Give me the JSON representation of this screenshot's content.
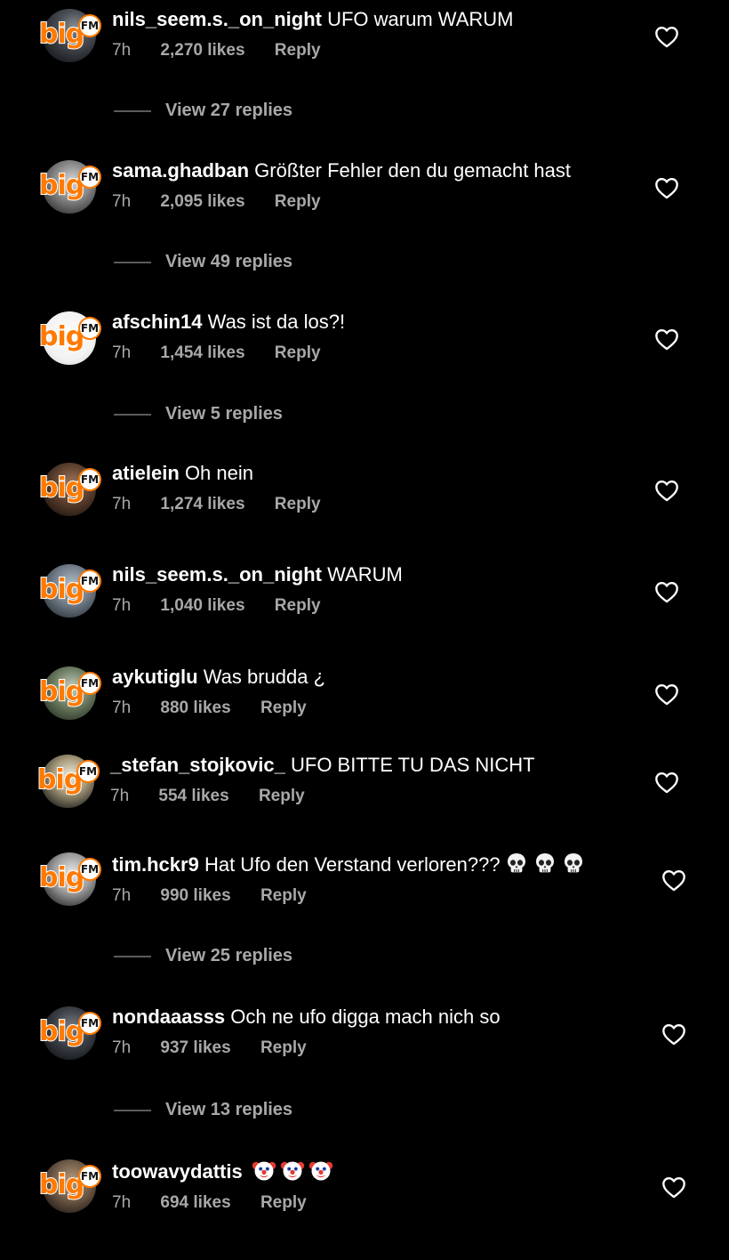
{
  "brand": {
    "logo_text": "big",
    "logo_badge": "FM",
    "logo_color": "#ff7a00"
  },
  "comments": [
    {
      "user": "nils_seem.s._on_night",
      "text": "UFO warum WARUM",
      "time": "7h",
      "likes": "2,270 likes",
      "reply": "Reply",
      "view_replies": "View 27 replies"
    },
    {
      "user": "sama.ghadban",
      "text": "Größter Fehler den du gemacht hast",
      "time": "7h",
      "likes": "2,095 likes",
      "reply": "Reply",
      "view_replies": "View 49 replies"
    },
    {
      "user": "afschin14",
      "text": "Was ist da los?!",
      "time": "7h",
      "likes": "1,454 likes",
      "reply": "Reply",
      "view_replies": "View 5 replies"
    },
    {
      "user": "atielein",
      "text": "Oh nein",
      "time": "7h",
      "likes": "1,274 likes",
      "reply": "Reply"
    },
    {
      "user": "nils_seem.s._on_night",
      "text": "WARUM",
      "time": "7h",
      "likes": "1,040 likes",
      "reply": "Reply"
    },
    {
      "user": "aykutiglu",
      "text": "Was brudda ¿",
      "time": "7h",
      "likes": "880 likes",
      "reply": "Reply"
    },
    {
      "user": "_stefan_stojkovic_",
      "text": "UFO BITTE TU DAS NICHT",
      "time": "7h",
      "likes": "554 likes",
      "reply": "Reply"
    },
    {
      "user": "tim.hckr9",
      "text": "Hat Ufo den Verstand verloren???",
      "emojis": [
        "skull",
        "skull",
        "skull"
      ],
      "time": "7h",
      "likes": "990 likes",
      "reply": "Reply",
      "view_replies": "View 25 replies"
    },
    {
      "user": "nondaaasss",
      "text": "Och ne ufo digga mach nich so",
      "time": "7h",
      "likes": "937 likes",
      "reply": "Reply",
      "view_replies": "View 13 replies"
    },
    {
      "user": "toowavydattis",
      "text": "",
      "emojis": [
        "clown-face",
        "clown-face",
        "clown-face"
      ],
      "time": "7h",
      "likes": "694 likes",
      "reply": "Reply"
    }
  ]
}
